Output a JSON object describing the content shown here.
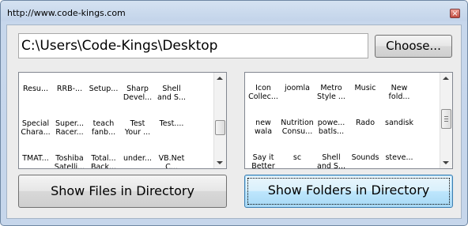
{
  "window": {
    "title": "http://www.code-kings.com",
    "close_glyph": "×"
  },
  "path": {
    "value": "C:\\Users\\Code-Kings\\Desktop"
  },
  "buttons": {
    "choose": "Choose...",
    "show_files": "Show Files in Directory",
    "show_folders": "Show Folders in Directory"
  },
  "files_list": {
    "items": [
      "Resu...",
      "RRB-...",
      "Setup...",
      "Sharp\nDevel...",
      "Shell\nand S...",
      "Special\nChara...",
      "Super...\nRacer...",
      "teach\nfanb...",
      "Test\nYour ...",
      "Test....",
      "TMAT...",
      "Toshiba\nSatelli...",
      "Total...\nBack...",
      "under...",
      "VB.Net\nC..."
    ]
  },
  "folders_list": {
    "items": [
      "Icon\nCollec...",
      "joomla",
      "Metro\nStyle ...",
      "Music",
      "New\nfold...",
      "new\nwala",
      "Nutrition\nConsu...",
      "powe...\nbatls...",
      "Rado",
      "sandisk",
      "Say it\nBetter",
      "sc",
      "Shell\nand S...",
      "Sounds",
      "steve..."
    ]
  },
  "colors": {
    "accent": "#3c7fb1",
    "title_gradient_top": "#d5e2f1",
    "close": "#c24a3d"
  },
  "icons": [
    "close-icon",
    "scroll-up-arrow-icon",
    "scroll-down-arrow-icon"
  ]
}
